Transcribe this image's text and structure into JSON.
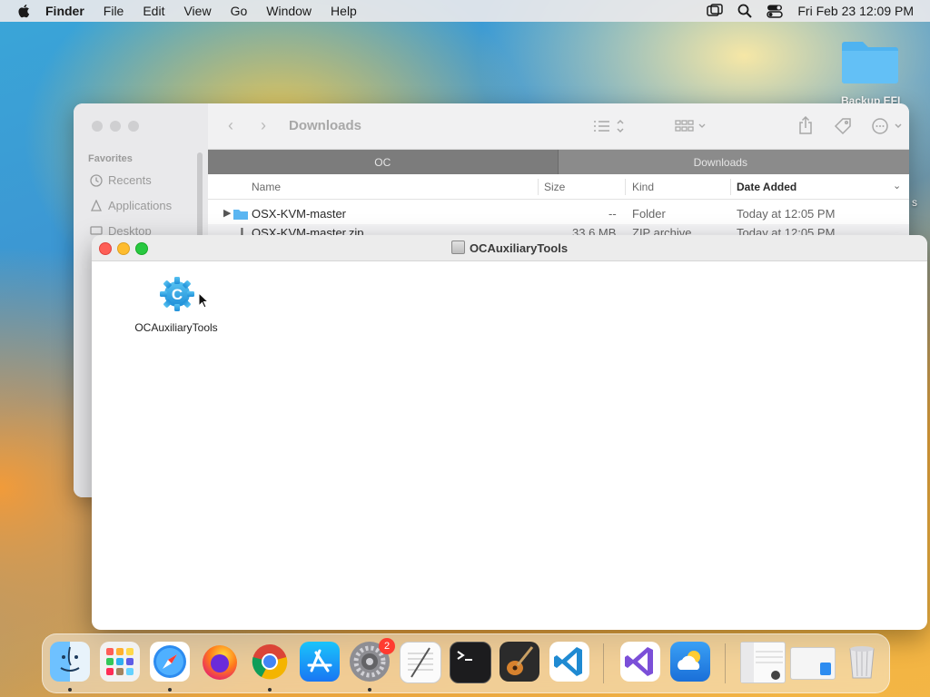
{
  "menubar": {
    "app_name": "Finder",
    "menus": [
      "File",
      "Edit",
      "View",
      "Go",
      "Window",
      "Help"
    ],
    "clock": "Fri Feb 23  12:09 PM"
  },
  "desktop": {
    "folder_label": "Backup EFI",
    "edge_text": "s"
  },
  "back_window": {
    "title": "Downloads",
    "sidebar_heading": "Favorites",
    "sidebar_items": [
      "Recents",
      "Applications",
      "Desktop"
    ],
    "path_tabs": [
      "OC",
      "Downloads"
    ],
    "columns": {
      "name": "Name",
      "size": "Size",
      "kind": "Kind",
      "date": "Date Added"
    },
    "rows": [
      {
        "name": "OSX-KVM-master",
        "size": "--",
        "kind": "Folder",
        "date": "Today at 12:05 PM"
      },
      {
        "name": "OSX-KVM-master.zip",
        "size": "33.6 MB",
        "kind": "ZIP archive",
        "date": "Today at 12:05 PM"
      }
    ]
  },
  "front_window": {
    "title": "OCAuxiliaryTools",
    "item_label": "OCAuxiliaryTools"
  },
  "dock": {
    "apps": [
      "finder",
      "launchpad",
      "safari",
      "firefox",
      "chrome",
      "app-store",
      "system-settings",
      "textedit",
      "terminal",
      "garageband",
      "vscode",
      "visual-studio",
      "cloud-app",
      "finder-window",
      "preview-window",
      "trash"
    ],
    "settings_badge": "2"
  },
  "colors": {
    "accent": "#0a7aff",
    "close": "#fe5f57",
    "minimize": "#febc2e",
    "zoom": "#28c840"
  }
}
